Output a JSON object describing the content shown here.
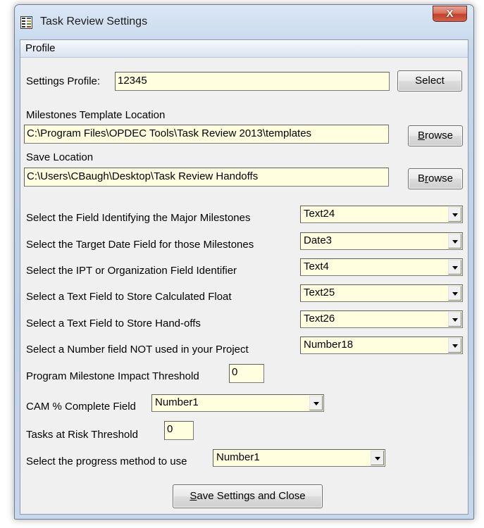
{
  "window": {
    "title": "Task Review Settings",
    "close_glyph": "X"
  },
  "menubar": {
    "items": [
      "Profile"
    ]
  },
  "profile": {
    "label": "Settings Profile:",
    "value": "12345",
    "select_label": "Select"
  },
  "milestones_template": {
    "label": "Milestones Template Location",
    "value": "C:\\Program Files\\OPDEC Tools\\Task Review 2013\\templates",
    "browse_prefix": "",
    "browse_accel": "B",
    "browse_rest": "rowse"
  },
  "save_location": {
    "label": "Save Location",
    "value": "C:\\Users\\CBaugh\\Desktop\\Task Review Handoffs",
    "browse_prefix": "B",
    "browse_accel": "r",
    "browse_rest": "owse"
  },
  "fields": [
    {
      "label": "Select the Field Identifying the Major Milestones",
      "value": "Text24"
    },
    {
      "label": "Select the Target Date Field for those Milestones",
      "value": "Date3"
    },
    {
      "label": "Select the IPT or Organization Field Identifier",
      "value": "Text4"
    },
    {
      "label": "Select a Text Field to Store Calculated Float",
      "value": "Text25"
    },
    {
      "label": "Select a Text Field to Store Hand-offs",
      "value": "Text26"
    },
    {
      "label": "Select a Number field NOT used in your Project",
      "value": "Number18"
    }
  ],
  "impact_threshold": {
    "label": "Program Milestone Impact Threshold",
    "value": "0"
  },
  "cam_complete": {
    "label": "CAM % Complete Field",
    "value": "Number1"
  },
  "risk_threshold": {
    "label": "Tasks at Risk Threshold",
    "value": "0"
  },
  "progress_method": {
    "label": "Select the progress method to use",
    "value": "Number1"
  },
  "save_button": {
    "accel": "S",
    "rest": "ave Settings and Close"
  },
  "colors": {
    "field_bg": "#ffffe0",
    "client_bg": "#f0f0f0",
    "close_red": "#c4402a"
  },
  "icons": {
    "app": "list-icon",
    "dropdown": "chevron-down-icon"
  }
}
